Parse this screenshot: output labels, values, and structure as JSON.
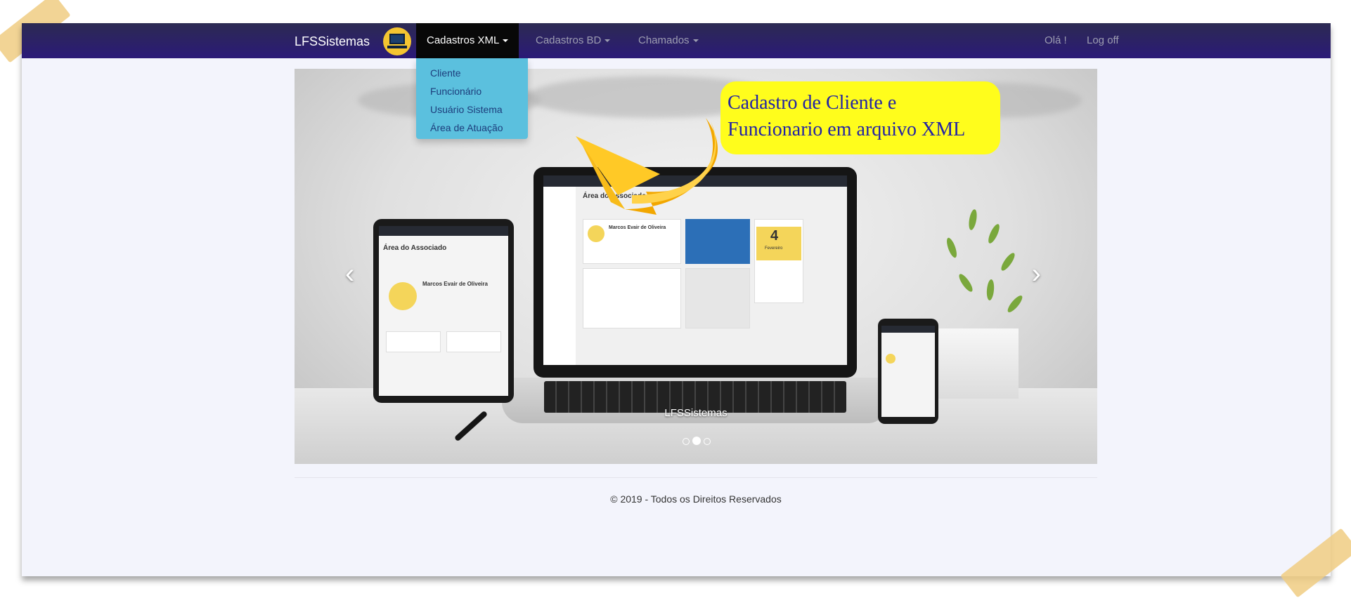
{
  "navbar": {
    "brand": "LFSSistemas",
    "menus": [
      {
        "label": "Cadastros XML",
        "active": true
      },
      {
        "label": "Cadastros BD",
        "active": false
      },
      {
        "label": "Chamados",
        "active": false
      }
    ],
    "right": {
      "greeting": "Olá !",
      "logoff": "Log off"
    },
    "colors": {
      "bar_top": "#2c2a52",
      "bar_bottom": "#2b1a78",
      "active_bg": "#080808"
    }
  },
  "dropdown": {
    "items": [
      "Cliente",
      "Funcionário",
      "Usuário Sistema",
      "Área de Atuação"
    ],
    "bg_color": "#5bc0de",
    "text_color": "#1d3d7c"
  },
  "carousel": {
    "callout_line1": "Cadastro de Cliente e",
    "callout_line2": "Funcionario em arquivo XML",
    "caption": "LFSSistemas",
    "prev_icon": "chevron-left-icon",
    "next_icon": "chevron-right-icon",
    "indicators": 3,
    "active_indicator": 1,
    "mockup": {
      "screen_title": "Área do Associado",
      "member_name": "Marcos Evair de Oliveira",
      "calendar_day": "4",
      "calendar_month": "Fevereiro"
    }
  },
  "footer": {
    "text": "© 2019 - Todos os Direitos Reservados"
  }
}
